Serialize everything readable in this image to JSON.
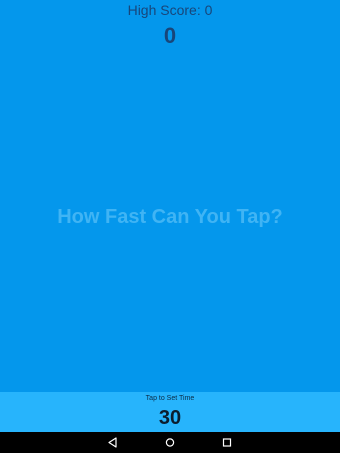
{
  "header": {
    "high_score_label": "High Score: 0",
    "score": "0"
  },
  "main": {
    "prompt": "How Fast Can You Tap?"
  },
  "timer": {
    "label": "Tap to Set Time",
    "value": "30"
  },
  "nav": {
    "icons": [
      "back-icon",
      "home-icon",
      "recents-icon"
    ]
  },
  "colors": {
    "background": "#0497ec",
    "timer_bar": "#27b4fc",
    "score_text": "#18467a",
    "prompt_text": "#40b4f4",
    "nav_bar": "#000000"
  }
}
